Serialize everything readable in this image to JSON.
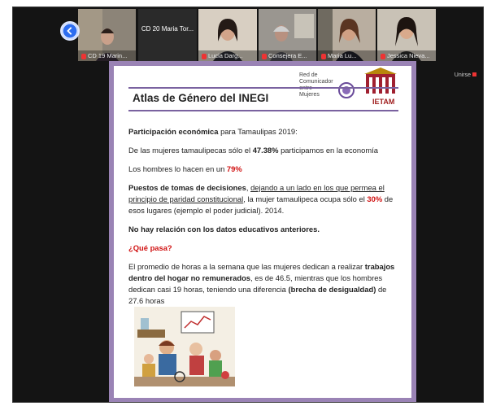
{
  "participants": [
    {
      "name": "CD 19 Marin..."
    },
    {
      "name": "CD 20 Maria Tor..."
    },
    {
      "name": "Lucia Darg..."
    },
    {
      "name": "Consejera E..."
    },
    {
      "name": "Maria Lu..."
    },
    {
      "name": "Jessica Nieva..."
    }
  ],
  "side_label": "Unirse",
  "slide": {
    "title": "Atlas de Género del INEGI",
    "logo_text": "Red de Comunicador entre Mujeres",
    "logo_text_bold": "entre Mujeres",
    "logo_name": "IETAM",
    "p1_bold": "Participación económica",
    "p1_rest": " para Tamaulipas 2019:",
    "p2_a": "De las mujeres tamaulipecas sólo el ",
    "p2_b": "47.38%",
    "p2_c": " participamos en la economía",
    "p3_a": "Los hombres lo hacen en un ",
    "p3_b": "79%",
    "p4_a": "Puestos de tomas de decisiones",
    "p4_b": ", ",
    "p4_c": "dejando a un lado en los que permea el principio de paridad constitucional",
    "p4_d": ", la mujer tamaulipeca ocupa sólo el ",
    "p4_e": "30%",
    "p4_f": " de esos lugares (ejemplo el poder judicial). 2014.",
    "p5": "No hay relación con los datos educativos anteriores.",
    "p6": "¿Qué pasa?",
    "p7_a": "El promedio de horas a la semana que las mujeres dedican a realizar ",
    "p7_b": "trabajos dentro del hogar no remunerados",
    "p7_c": ", es de 46.5, mientras que los hombres dedican casi 19 horas, teniendo una diferencia ",
    "p7_d": "(brecha de desigualdad)",
    "p7_e": " de 27.6 horas"
  }
}
